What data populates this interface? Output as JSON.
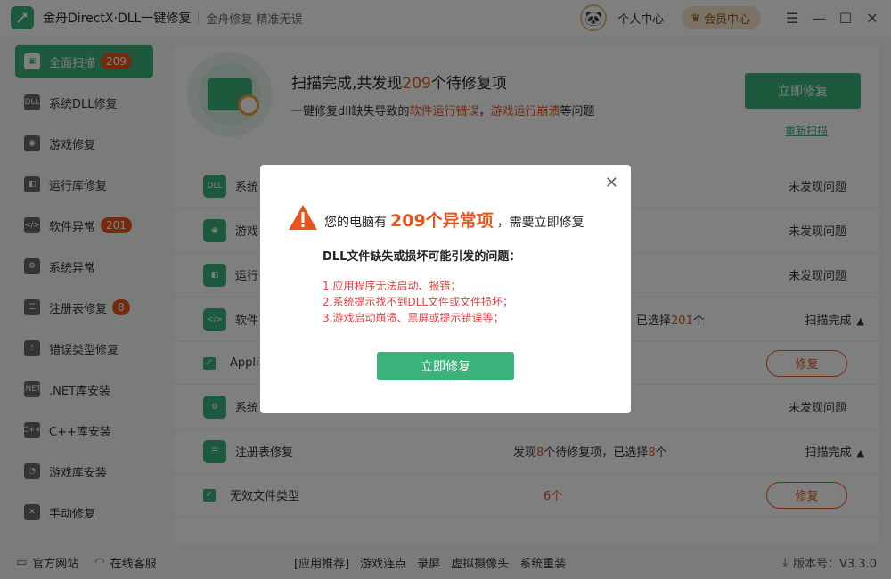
{
  "titlebar": {
    "app_title": "金舟DirectX·DLL一键修复",
    "slogan": "金舟修复 精准无误",
    "personal_center": "个人中心",
    "vip_center": "会员中心"
  },
  "sidebar": {
    "items": [
      {
        "label": "全面扫描",
        "badge": "209",
        "icon": "scan-icon"
      },
      {
        "label": "系统DLL修复",
        "icon": "dll-icon"
      },
      {
        "label": "游戏修复",
        "icon": "gamepad-icon"
      },
      {
        "label": "运行库修复",
        "icon": "vs-icon"
      },
      {
        "label": "软件异常",
        "badge": "201",
        "icon": "code-icon"
      },
      {
        "label": "系统异常",
        "icon": "gear-icon"
      },
      {
        "label": "注册表修复",
        "badge": "8",
        "icon": "list-icon"
      },
      {
        "label": "错误类型修复",
        "icon": "warning-icon"
      },
      {
        "label": ".NET库安装",
        "icon": "net-icon"
      },
      {
        "label": "C++库安装",
        "icon": "cpp-icon"
      },
      {
        "label": "游戏库安装",
        "icon": "pacman-icon"
      },
      {
        "label": "手动修复",
        "icon": "wrench-icon"
      }
    ]
  },
  "banner": {
    "title_prefix": "扫描完成,共发现",
    "title_count": "209",
    "title_suffix": "个待修复项",
    "sub_prefix": "一键修复dll缺失导致的",
    "sub_hl1": "软件运行错误",
    "sub_sep": "，",
    "sub_hl2": "游戏运行崩溃",
    "sub_suffix": "等问题",
    "fix_button": "立即修复",
    "rescan": "重新扫描"
  },
  "list": {
    "row1": {
      "title": "系统",
      "status": "未发现问题"
    },
    "row2": {
      "title": "游戏",
      "status": "未发现问题"
    },
    "row3": {
      "title": "运行",
      "status": "未发现问题"
    },
    "row4": {
      "title": "软件",
      "mid_prefix": "已选择",
      "mid_count": "201",
      "mid_suffix": "个",
      "status": "扫描完成"
    },
    "row5": {
      "title": "Appli",
      "fix": "修复"
    },
    "row6": {
      "title": "系统",
      "status": "未发现问题"
    },
    "row7": {
      "title": "注册表修复",
      "mid_prefix": "发现",
      "mid_count1": "8",
      "mid_middle": "个待修复项，已选择",
      "mid_count2": "8",
      "mid_suffix": "个",
      "status": "扫描完成"
    },
    "row8": {
      "title": "无效文件类型",
      "count": "6个",
      "fix": "修复"
    }
  },
  "footer": {
    "website": "官方网站",
    "service": "在线客服",
    "links": [
      "[应用推荐]",
      "游戏连点",
      "录屏",
      "虚拟摄像头",
      "系统重装"
    ],
    "version": "版本号：V3.3.0"
  },
  "dialog": {
    "head_prefix": "您的电脑有",
    "head_count": "209个异常项",
    "head_suffix": "，需要立即修复",
    "subtitle": "DLL文件缺失或损坏可能引发的问题：",
    "lines": [
      "1.应用程序无法启动、报错；",
      "2.系统提示找不到DLL文件或文件损坏；",
      "3.游戏启动崩溃、黑屏或提示错误等；"
    ],
    "button": "立即修复"
  },
  "colors": {
    "brand": "#3ab27a",
    "accent": "#e8541e",
    "alert": "#e84040"
  }
}
